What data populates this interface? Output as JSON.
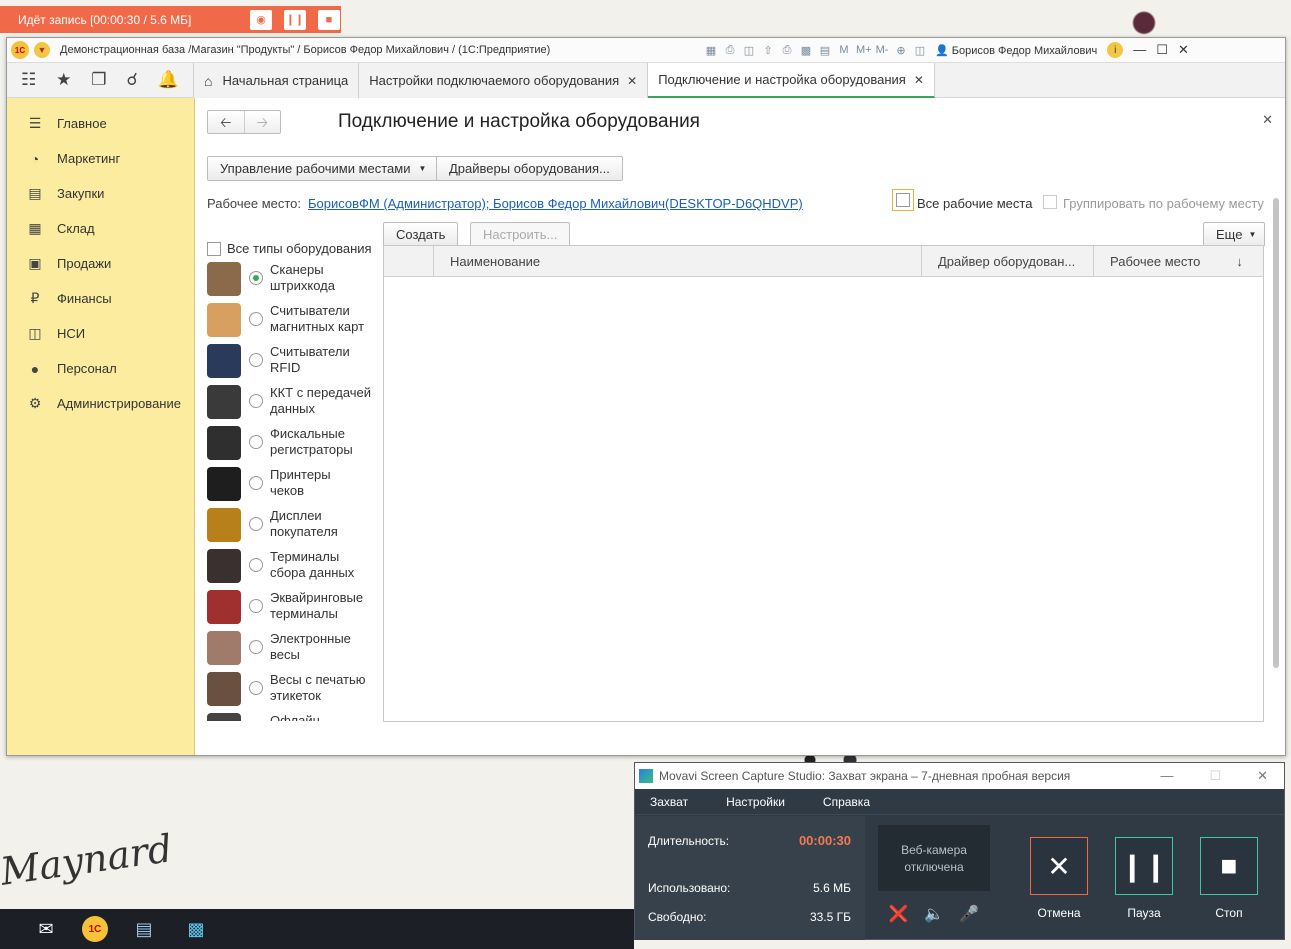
{
  "recording": {
    "status": "Идёт запись [00:00:30 / 5.6 МБ]",
    "photo_icon": "camera-icon",
    "pause_icon": "pause-icon",
    "stop_icon": "stop-icon"
  },
  "window": {
    "title": "Демонстрационная база /Магазин \"Продукты\" / Борисов Федор Михайлович / (1С:Предприятие)",
    "user": "Борисов Федор Михайлович",
    "toolbar_icons": [
      "save-icon",
      "print-icon",
      "preview-icon",
      "attach-icon",
      "print-icon-2",
      "calculator-icon",
      "calendar-icon",
      "M",
      "M+",
      "M-",
      "zoom-icon",
      "panel-icon"
    ]
  },
  "tabs": [
    {
      "label": "Начальная страница"
    },
    {
      "label": "Настройки подключаемого оборудования"
    },
    {
      "label": "Подключение и настройка оборудования"
    }
  ],
  "sidebar": {
    "items": [
      {
        "label": "Главное",
        "icon": "menu-icon"
      },
      {
        "label": "Маркетинг",
        "icon": "pie-chart-icon"
      },
      {
        "label": "Закупки",
        "icon": "cart-icon"
      },
      {
        "label": "Склад",
        "icon": "warehouse-icon"
      },
      {
        "label": "Продажи",
        "icon": "basket-icon"
      },
      {
        "label": "Финансы",
        "icon": "ruble-icon"
      },
      {
        "label": "НСИ",
        "icon": "books-icon"
      },
      {
        "label": "Персонал",
        "icon": "person-icon"
      },
      {
        "label": "Администрирование",
        "icon": "gear-icon"
      }
    ]
  },
  "form": {
    "title": "Подключение и настройка оборудования",
    "manage_workplaces": "Управление рабочими местами",
    "drivers": "Драйверы оборудования...",
    "workplace_label": "Рабочее место:",
    "workplace_value": "БорисовФМ (Администратор); Борисов Федор Михайлович(DESKTOP-D6QHDVP)",
    "all_workplaces": "Все рабочие места",
    "group_by_workplace": "Группировать по рабочему месту",
    "create": "Создать",
    "configure": "Настроить...",
    "more": "Еще",
    "all_types": "Все типы оборудования",
    "columns": [
      "Наименование",
      "Драйвер оборудован...",
      "Рабочее место"
    ],
    "sort_icon": "arrow-down-icon"
  },
  "equipment_types": [
    {
      "label1": "Сканеры",
      "label2": "штрихкода",
      "selected": true,
      "color": "#8a6a4a"
    },
    {
      "label1": "Считыватели",
      "label2": "магнитных карт",
      "selected": false,
      "color": "#d8a060"
    },
    {
      "label1": "Считыватели",
      "label2": "RFID",
      "selected": false,
      "color": "#2a3a5a"
    },
    {
      "label1": "ККТ с передачей",
      "label2": "данных",
      "selected": false,
      "color": "#3a3a3a"
    },
    {
      "label1": "Фискальные",
      "label2": "регистраторы",
      "selected": false,
      "color": "#2f2f2f"
    },
    {
      "label1": "Принтеры",
      "label2": "чеков",
      "selected": false,
      "color": "#1e1e1e"
    },
    {
      "label1": "Дисплеи",
      "label2": "покупателя",
      "selected": false,
      "color": "#b8801a"
    },
    {
      "label1": "Терминалы",
      "label2": "сбора данных",
      "selected": false,
      "color": "#3a3030"
    },
    {
      "label1": "Эквайринговые",
      "label2": "терминалы",
      "selected": false,
      "color": "#a03030"
    },
    {
      "label1": "Электронные",
      "label2": "весы",
      "selected": false,
      "color": "#a07a6a"
    },
    {
      "label1": "Весы с печатью",
      "label2": "этикеток",
      "selected": false,
      "color": "#6a5040"
    },
    {
      "label1": "Офлайн",
      "label2": "",
      "selected": false,
      "color": "#444444"
    }
  ],
  "movavi": {
    "title": "Movavi Screen Capture Studio: Захват экрана – 7-дневная пробная версия",
    "menu": [
      "Захват",
      "Настройки",
      "Справка"
    ],
    "duration_label": "Длительность:",
    "duration_value": "00:00:30",
    "used_label": "Использовано:",
    "used_value": "5.6 МБ",
    "free_label": "Свободно:",
    "free_value": "33.5 ГБ",
    "webcam": "Веб-камера отключена",
    "cancel": "Отмена",
    "pause": "Пауза",
    "stop": "Стоп"
  },
  "desktop": {
    "signature": "Maynard"
  }
}
